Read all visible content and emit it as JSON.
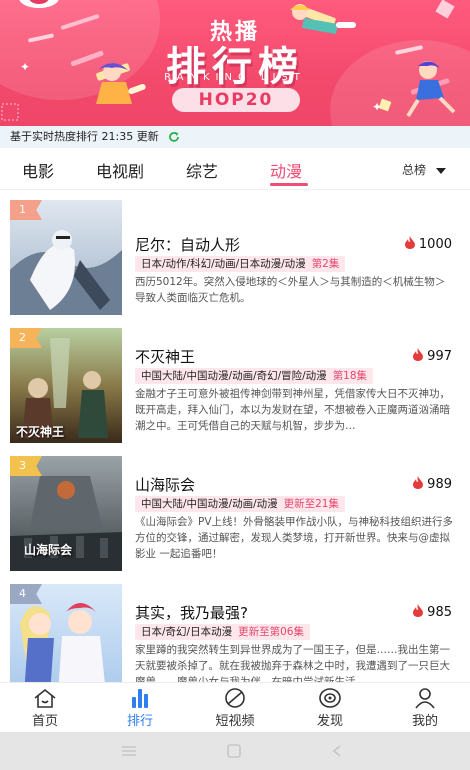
{
  "banner": {
    "title_small": "热播",
    "title_big": "排行榜",
    "subtitle": "RANKING LIST",
    "pill": "HOP20"
  },
  "update_bar": {
    "text": "基于实时热度排行 21:35 更新",
    "refresh_icon": "refresh-icon",
    "accent": "#2fb04a"
  },
  "tabs": {
    "items": [
      {
        "label": "电影"
      },
      {
        "label": "电视剧"
      },
      {
        "label": "综艺"
      },
      {
        "label": "动漫",
        "active": true
      }
    ],
    "rank_select": "总榜",
    "accent": "#ee4e74"
  },
  "list": {
    "items": [
      {
        "rank": "1",
        "title": "尼尔：自动人形",
        "heat": "1000",
        "tags": "日本/动作/科幻/动画/日本动漫/动漫",
        "episode": "第2集",
        "desc": "西历5012年。突然入侵地球的＜外星人＞与其制造的＜机械生物＞导致人类面临灭亡危机。",
        "badge_color": "#f4a08a"
      },
      {
        "rank": "2",
        "title": "不灭神王",
        "heat": "997",
        "tags": "中国大陆/中国动漫/动画/奇幻/冒险/动漫",
        "episode": "第18集",
        "desc": "金融才子王可意外被祖传神剑带到神州星，凭借家传大日不灭神功，既开高走，拜入仙门，本以为发财在望，不想被卷入正魔两道汹涌暗潮之中。王可凭借自己的天赋与机智，步步为…",
        "poster_caption": "不灭神王",
        "badge_color": "#f5b35a"
      },
      {
        "rank": "3",
        "title": "山海际会",
        "heat": "989",
        "tags": "中国大陆/中国动漫/动画/动漫",
        "episode": "更新至21集",
        "desc": "《山海际会》PV上线！外骨骼装甲作战小队，与神秘科技组织进行多方位的交锋，通过解密，发现人类梦境，打开新世界。快来与@虚拟影业 一起追番吧！",
        "poster_caption": "山海际会",
        "badge_color": "#f2c14e"
      },
      {
        "rank": "4",
        "title": "其实，我乃最强?",
        "heat": "985",
        "tags": "日本/奇幻/日本动漫",
        "episode": "更新至第06集",
        "desc": "家里蹲的我突然转生到异世界成为了一国王子，但是……我出生第一天就要被杀掉了。就在我被抛弃于森林之中时，我遭遇到了一只巨大魔兽……魔兽少女与我为伴，在暗中尝试新生活…",
        "badge_color": "#9aa8c4"
      }
    ],
    "flame_color": "#e43a3a"
  },
  "bottom_nav": {
    "items": [
      {
        "label": "首页",
        "icon": "home-icon"
      },
      {
        "label": "排行",
        "icon": "ranking-icon",
        "active": true
      },
      {
        "label": "短视频",
        "icon": "short-video-icon"
      },
      {
        "label": "发现",
        "icon": "discover-icon"
      },
      {
        "label": "我的",
        "icon": "profile-icon"
      }
    ],
    "active_color": "#2f7ff2"
  },
  "system_bar": {
    "icons": [
      "menu-icon",
      "home-square-icon",
      "back-icon"
    ]
  }
}
